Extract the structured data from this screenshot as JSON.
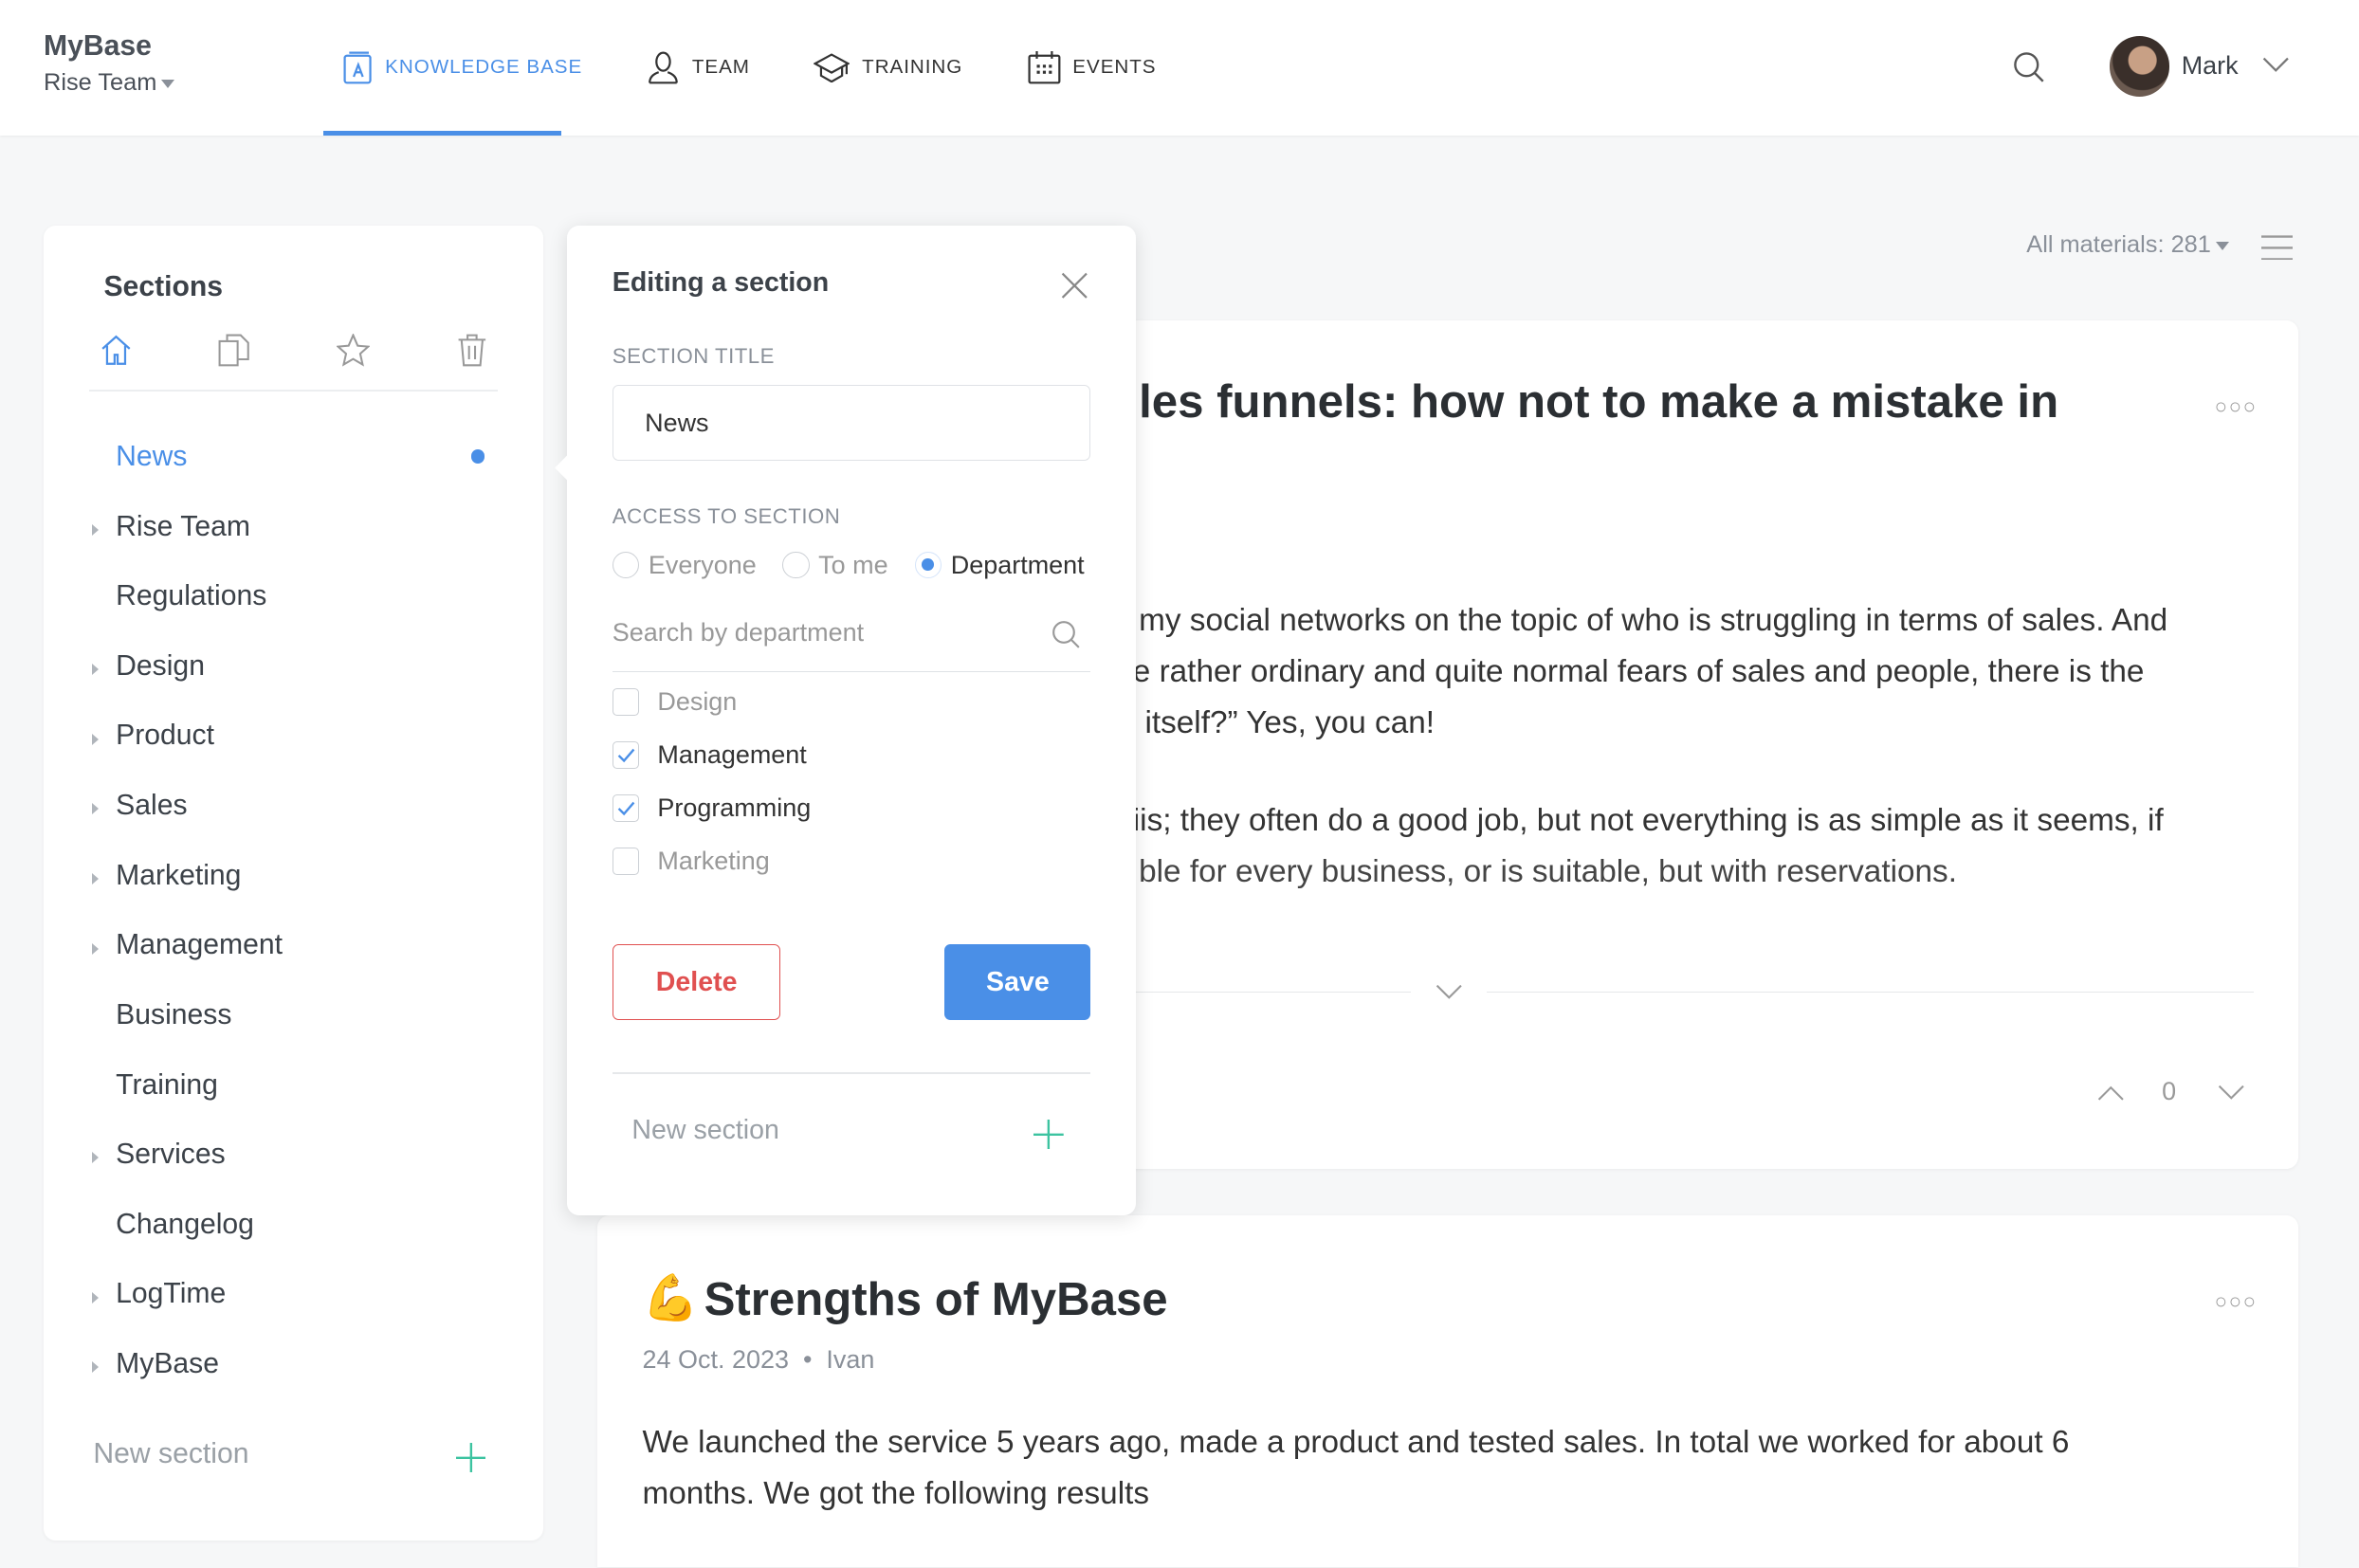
{
  "header": {
    "logo": "MyBase",
    "team": "Rise Team",
    "nav": [
      {
        "label": "KNOWLEDGE BASE",
        "icon": "book-icon",
        "active": true
      },
      {
        "label": "TEAM",
        "icon": "user-icon"
      },
      {
        "label": "TRAINING",
        "icon": "graduation-cap-icon"
      },
      {
        "label": "EVENTS",
        "icon": "calendar-icon"
      }
    ],
    "user": "Mark"
  },
  "sidebar": {
    "title": "Sections",
    "items": [
      {
        "label": "News",
        "active": true,
        "expandable": false
      },
      {
        "label": "Rise Team",
        "expandable": true
      },
      {
        "label": "Regulations",
        "expandable": false
      },
      {
        "label": "Design",
        "expandable": true
      },
      {
        "label": "Product",
        "expandable": true
      },
      {
        "label": "Sales",
        "expandable": true
      },
      {
        "label": "Marketing",
        "expandable": true
      },
      {
        "label": "Management",
        "expandable": true
      },
      {
        "label": "Business",
        "expandable": false
      },
      {
        "label": "Training",
        "expandable": false
      },
      {
        "label": "Services",
        "expandable": true
      },
      {
        "label": "Changelog",
        "expandable": false
      },
      {
        "label": "LogTime",
        "expandable": true
      },
      {
        "label": "MyBase",
        "expandable": true
      }
    ],
    "new_section": "New section"
  },
  "editor": {
    "title": "Editing a section",
    "section_title_label": "SECTION TITLE",
    "section_title_value": "News",
    "access_label": "ACCESS TO SECTION",
    "access_options": [
      "Everyone",
      "To me",
      "Department"
    ],
    "access_selected": "Department",
    "dept_search_placeholder": "Search by department",
    "departments": [
      {
        "label": "Design",
        "checked": false
      },
      {
        "label": "Management",
        "checked": true
      },
      {
        "label": "Programming",
        "checked": true
      },
      {
        "label": "Marketing",
        "checked": false
      }
    ],
    "delete": "Delete",
    "save": "Save",
    "new_section": "New section"
  },
  "toolbar": {
    "materials": "All materials: 281"
  },
  "articles": [
    {
      "title": "les funnels: how not to make a mistake in",
      "paragraphs": [
        "my social networks on the topic of who is struggling in terms of sales. And",
        "e rather ordinary and quite normal fears of sales and people, there is the",
        "itself?” Yes, you can!",
        "iis; they often do a good job, but not everything is as simple as it seems, if",
        "ble for every business, or is suitable, but with reservations."
      ],
      "votes": "0"
    },
    {
      "emoji": "💪",
      "title": "Strengths of MyBase",
      "date": "24 Oct. 2023",
      "author": "Ivan",
      "paragraphs": [
        "We launched the service 5 years ago, made a product and tested sales. In total we worked for about 6",
        "months. We got the following results"
      ]
    }
  ],
  "colors": {
    "accent": "#4a8fe7",
    "danger": "#e05050",
    "plus": "#3cc3a0"
  }
}
